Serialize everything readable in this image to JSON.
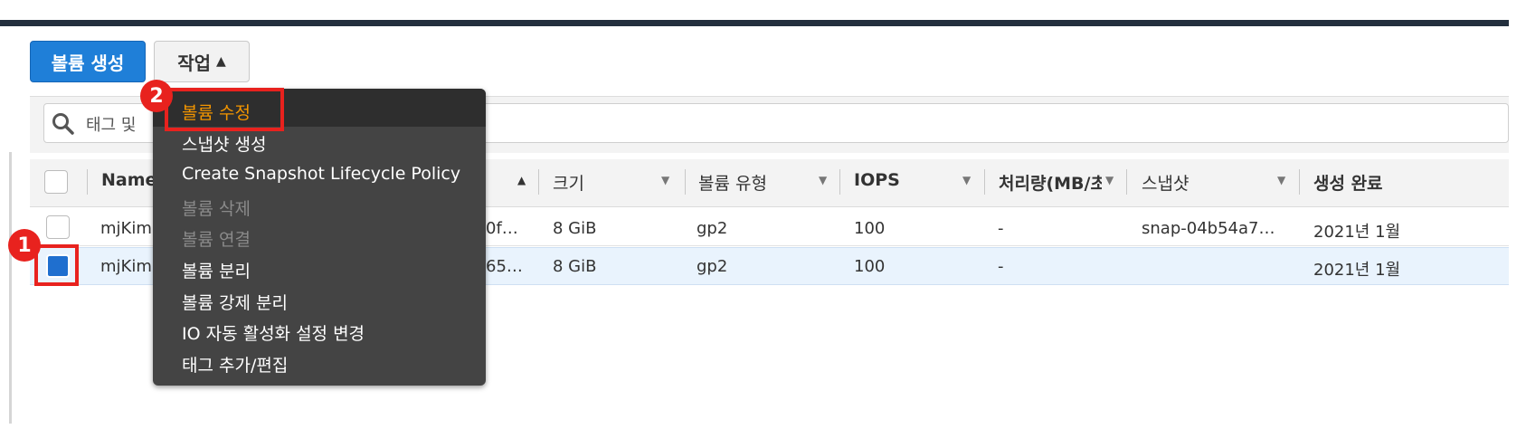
{
  "toolbar": {
    "create_label": "볼륨 생성",
    "actions_label": "작업"
  },
  "search": {
    "placeholder": "태그 및"
  },
  "table": {
    "columns": [
      "Name",
      "크기",
      "볼륨 유형",
      "IOPS",
      "처리량(MB/초",
      "스냅샷",
      "생성 완료"
    ],
    "rows": [
      {
        "name": "mjKim",
        "volume_id": "0f…",
        "size": "8 GiB",
        "type": "gp2",
        "iops": "100",
        "throughput": "-",
        "snapshot": "snap-04b54a7…",
        "created": "2021년 1월",
        "selected": false
      },
      {
        "name": "mjKim",
        "volume_id": "65…",
        "size": "8 GiB",
        "type": "gp2",
        "iops": "100",
        "throughput": "-",
        "snapshot": "",
        "created": "2021년 1월",
        "selected": true
      }
    ]
  },
  "menu": {
    "items": [
      {
        "label": "볼륨 수정",
        "state": "active"
      },
      {
        "label": "스냅샷 생성",
        "state": "enabled"
      },
      {
        "label": "Create Snapshot Lifecycle Policy",
        "state": "enabled"
      },
      {
        "label": "볼륨 삭제",
        "state": "disabled"
      },
      {
        "label": "볼륨 연결",
        "state": "disabled"
      },
      {
        "label": "볼륨 분리",
        "state": "enabled"
      },
      {
        "label": "볼륨 강제 분리",
        "state": "enabled"
      },
      {
        "label": "IO 자동 활성화 설정 변경",
        "state": "enabled"
      },
      {
        "label": "태그 추가/편집",
        "state": "enabled"
      }
    ]
  },
  "annotations": {
    "step1": "1",
    "step2": "2"
  },
  "colors": {
    "primary": "#1f7fd8",
    "highlight": "#e8221e",
    "menu_bg": "#444444",
    "active_item": "#f29500"
  }
}
